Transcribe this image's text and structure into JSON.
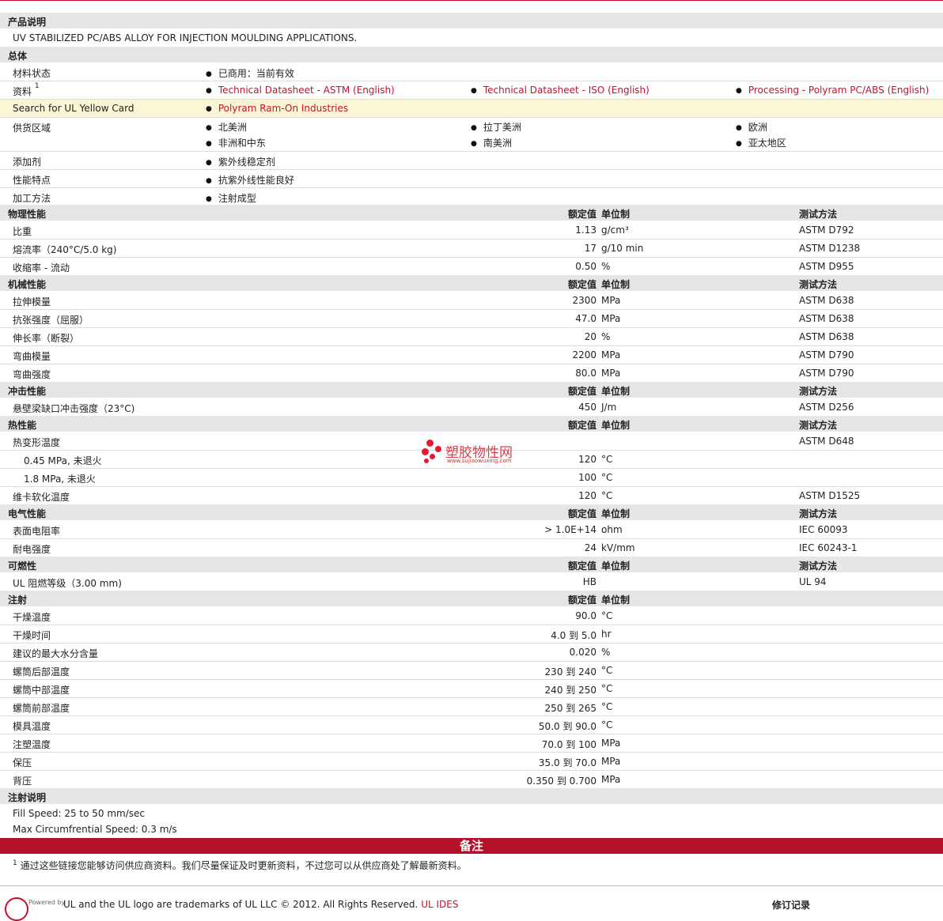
{
  "product_desc": {
    "heading": "产品说明",
    "text": "UV STABILIZED PC/ABS ALLOY FOR INJECTION MOULDING APPLICATIONS."
  },
  "general": {
    "heading": "总体",
    "status_label": "材料状态",
    "status_value": "已商用：当前有效",
    "docs_label": "资料",
    "docs_sup": "1",
    "docs": [
      "Technical Datasheet - ASTM (English)",
      "Technical Datasheet - ISO (English)",
      "Processing - Polyram PC/ABS (English)"
    ],
    "ul_label": "Search for UL Yellow Card",
    "ul_value": "Polyram Ram-On Industries",
    "regions_label": "供货区域",
    "regions": [
      "北美洲",
      "拉丁美洲",
      "欧洲",
      "非洲和中东",
      "南美洲",
      "亚太地区"
    ],
    "additive_label": "添加剂",
    "additive_value": "紫外线稳定剂",
    "feature_label": "性能特点",
    "feature_value": "抗紫外线性能良好",
    "process_label": "加工方法",
    "process_value": "注射成型"
  },
  "col_headers": {
    "value": "额定值",
    "unit": "单位制",
    "method": "测试方法"
  },
  "sections": {
    "physical": {
      "title": "物理性能",
      "rows": [
        {
          "label": "比重",
          "value": "1.13",
          "unit": "g/cm³",
          "method": "ASTM D792"
        },
        {
          "label": "熔流率（240°C/5.0 kg)",
          "value": "17",
          "unit": "g/10 min",
          "method": "ASTM D1238"
        },
        {
          "label": "收缩率 - 流动",
          "value": "0.50",
          "unit": "%",
          "method": "ASTM D955"
        }
      ]
    },
    "mechanical": {
      "title": "机械性能",
      "rows": [
        {
          "label": "拉伸模量",
          "value": "2300",
          "unit": "MPa",
          "method": "ASTM D638"
        },
        {
          "label": "抗张强度（屈服）",
          "value": "47.0",
          "unit": "MPa",
          "method": "ASTM D638"
        },
        {
          "label": "伸长率（断裂）",
          "value": "20",
          "unit": "%",
          "method": "ASTM D638"
        },
        {
          "label": "弯曲模量",
          "value": "2200",
          "unit": "MPa",
          "method": "ASTM D790"
        },
        {
          "label": "弯曲强度",
          "value": "80.0",
          "unit": "MPa",
          "method": "ASTM D790"
        }
      ]
    },
    "impact": {
      "title": "冲击性能",
      "rows": [
        {
          "label": "悬壁梁缺口冲击强度（23°C)",
          "value": "450",
          "unit": "J/m",
          "method": "ASTM D256"
        }
      ]
    },
    "thermal": {
      "title": "热性能",
      "rows": [
        {
          "label": "热变形温度",
          "value": "",
          "unit": "",
          "method": "ASTM D648"
        },
        {
          "label": "0.45 MPa, 未退火",
          "value": "120",
          "unit": "°C",
          "method": ""
        },
        {
          "label": "1.8 MPa, 未退火",
          "value": "100",
          "unit": "°C",
          "method": ""
        },
        {
          "label": "维卡软化温度",
          "value": "120",
          "unit": "°C",
          "method": "ASTM D1525"
        }
      ]
    },
    "electrical": {
      "title": "电气性能",
      "rows": [
        {
          "label": "表面电阻率",
          "value": "> 1.0E+14",
          "unit": "ohm",
          "method": "IEC 60093"
        },
        {
          "label": "耐电强度",
          "value": "24",
          "unit": "kV/mm",
          "method": "IEC 60243-1"
        }
      ]
    },
    "flammability": {
      "title": "可燃性",
      "rows": [
        {
          "label": "UL 阻燃等级（3.00 mm)",
          "value": "HB",
          "unit": "",
          "method": "UL 94"
        }
      ]
    },
    "injection": {
      "title": "注射",
      "rows": [
        {
          "label": "干燥温度",
          "value": "90.0",
          "unit": "°C",
          "method": ""
        },
        {
          "label": "干燥时间",
          "value": "4.0 到  5.0",
          "unit": "hr",
          "method": ""
        },
        {
          "label": "建议的最大水分含量",
          "value": "0.020",
          "unit": "%",
          "method": ""
        },
        {
          "label": "螺筒后部温度",
          "value": "230 到  240",
          "unit": "°C",
          "method": ""
        },
        {
          "label": "螺筒中部温度",
          "value": "240 到  250",
          "unit": "°C",
          "method": ""
        },
        {
          "label": "螺筒前部温度",
          "value": "250 到  265",
          "unit": "°C",
          "method": ""
        },
        {
          "label": "模具温度",
          "value": "50.0 到  90.0",
          "unit": "°C",
          "method": ""
        },
        {
          "label": "注塑温度",
          "value": "70.0 到  100",
          "unit": "MPa",
          "method": ""
        },
        {
          "label": "保压",
          "value": "35.0 到  70.0",
          "unit": "MPa",
          "method": ""
        },
        {
          "label": "背压",
          "value": "0.350 到  0.700",
          "unit": "MPa",
          "method": ""
        }
      ]
    }
  },
  "injection_notes": {
    "heading": "注射说明",
    "lines": [
      "Fill Speed: 25 to 50 mm/sec",
      "Max Circumfrential Speed: 0.3 m/s"
    ]
  },
  "notes": {
    "heading": "备注",
    "sup": "1",
    "text": "通过这些链接您能够访问供应商资料。我们尽量保证及时更新资料，不过您可以从供应商处了解最新资料。"
  },
  "watermark": {
    "name": "塑胶物性网",
    "url": "www.sujiaowuxing.com"
  },
  "footer": {
    "powered": "Powered by",
    "trademark": "UL and the UL logo are trademarks of UL LLC © 2012. All Rights Reserved.",
    "link": "UL IDES",
    "revision": "修订记录"
  },
  "colors": {
    "accent": "#c8102e",
    "section_bg": "#e6e6e6",
    "highlight_bg": "#fbf6d3"
  }
}
